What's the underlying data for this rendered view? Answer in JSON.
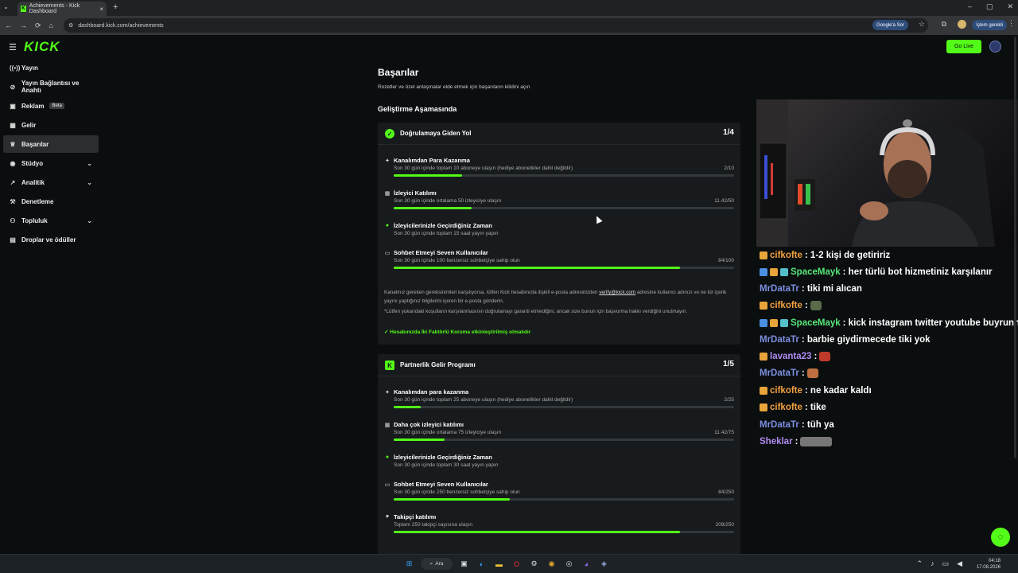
{
  "browser": {
    "tab_title": "Achievements - Kick Dashboard",
    "url": "dashboard.kick.com/achievements",
    "google_button": "Google'a Sor",
    "paused_label": "İşlem gerekli"
  },
  "header": {
    "logo": "KICK",
    "go_live": "Go Live"
  },
  "sidebar": {
    "items": [
      {
        "label": "Yayın",
        "icon": "broadcast-icon"
      },
      {
        "label": "Yayın Bağlantısı ve Anahtı",
        "icon": "link-icon"
      },
      {
        "label": "Reklam",
        "icon": "ad-icon",
        "badge": "Beta"
      },
      {
        "label": "Gelir",
        "icon": "money-icon"
      },
      {
        "label": "Başarılar",
        "icon": "trophy-icon",
        "active": true
      },
      {
        "label": "Stüdyo",
        "icon": "palette-icon",
        "expandable": true
      },
      {
        "label": "Analitik",
        "icon": "chart-icon",
        "expandable": true
      },
      {
        "label": "Denetleme",
        "icon": "hammer-icon"
      },
      {
        "label": "Topluluk",
        "icon": "people-icon",
        "expandable": true
      },
      {
        "label": "Droplar ve ödüller",
        "icon": "gift-icon"
      }
    ]
  },
  "main": {
    "title": "Başarılar",
    "subtitle": "Rozetler ve özel anlaşmalar elde etmek için başarıların kilidini açın",
    "section_title": "Geliştirme Aşamasında",
    "verify_card": {
      "title": "Doğrulamaya Giden Yol",
      "count": "1/4",
      "requirements": [
        {
          "title": "Kanalımdan Para Kazanma",
          "desc": "Son 30 gün içinde toplam 10 aboneye ulaşın (hediye abonelikler dahil değildir)",
          "value": "2/10",
          "progress": 0.2,
          "icon": "sparkle-icon"
        },
        {
          "title": "İzleyici Katılımı",
          "desc": "Son 30 gün içinde ortalama 50 izleyiciye ulaşın",
          "value": "11.42/50",
          "progress": 0.23,
          "icon": "audience-icon"
        },
        {
          "title": "İzleyicilerinizle Geçirdiğiniz Zaman",
          "desc": "Son 30 gün içinde toplam 15 saat yayın yapın",
          "value": "",
          "progress": null,
          "icon": "check-circle-icon",
          "complete": true
        },
        {
          "title": "Sohbet Etmeyi Seven Kullanıcılar",
          "desc": "Son 30 gün içinde 100 benzersiz sohbetçiye sahip olun",
          "value": "84/100",
          "progress": 0.84,
          "icon": "chat-icon"
        }
      ],
      "note_1a": "Kanalınız gereken gereksinimleri karşılıyorsa, lütfen Kick hesabınızla ilişkili e-posta adresinizden ",
      "note_email": "verify@kick.com",
      "note_1b": " adresine kullanıcı adınızı ve ne tür içerik yayını yaptığınız bilgilerini içeren bir e-posta gönderin.",
      "note_2": "*Lütfen yukarıdaki koşulların karşılanmasının doğrulamayı garanti etmediğini, ancak size bunun için başvurma hakkı verdiğini unutmayın.",
      "two_factor": "Hesabınızda İki Faktörlü Koruma etkinleştirilmiş olmalıdır"
    },
    "partner_card": {
      "title": "Partnerlik Gelir Programı",
      "count": "1/5",
      "requirements": [
        {
          "title": "Kanalımdan para kazanma",
          "desc": "Son 30 gün içinde toplam 25 aboneye ulaşın (hediye abonelikler dahil değildir)",
          "value": "2/25",
          "progress": 0.08,
          "icon": "sparkle-icon"
        },
        {
          "title": "Daha çok izleyici katılımı",
          "desc": "Son 30 gün içinde ortalama 75 izleyiciye ulaşın",
          "value": "11.42/75",
          "progress": 0.15,
          "icon": "audience-icon"
        },
        {
          "title": "İzleyicilerinizle Geçirdiğiniz Zaman",
          "desc": "Son 30 gün içinde toplam 30 saat yayın yapın",
          "value": "",
          "progress": null,
          "icon": "check-circle-icon",
          "complete": true
        },
        {
          "title": "Sohbet Etmeyi Seven Kullanıcılar",
          "desc": "Son 30 gün içinde 250 benzersiz sohbetçiye sahip olun",
          "value": "84/250",
          "progress": 0.34,
          "icon": "chat-icon"
        },
        {
          "title": "Takipçi katılımı",
          "desc": "Toplam 250 takipçi sayısına ulaşın",
          "value": "209/250",
          "progress": 0.84,
          "icon": "heart-icon"
        }
      ]
    }
  },
  "chat": {
    "messages": [
      {
        "user": "cifkofte",
        "text": ": 1-2 kişi de getiririz",
        "color": "orange",
        "badges": [
          "#e8a33a"
        ]
      },
      {
        "user": "SpaceMayk",
        "text": ": her türlü bot hizmetiniz karşılanır",
        "color": "green",
        "badges": [
          "#4a90e2",
          "#e8a33a",
          "#53c0c9"
        ]
      },
      {
        "user": "MrDataTr",
        "text": ": tiki mi alıcan",
        "color": "blue",
        "badges": []
      },
      {
        "user": "cifkofte",
        "text": ":",
        "color": "orange",
        "badges": [
          "#e8a33a"
        ],
        "emote": "#5a6a4a"
      },
      {
        "user": "SpaceMayk",
        "text": ": kick instagram twitter youtube buyrunn",
        "color": "green",
        "badges": [
          "#4a90e2",
          "#e8a33a",
          "#53c0c9"
        ]
      },
      {
        "user": "MrDataTr",
        "text": ": barbie giydirmecede tiki yok",
        "color": "blue",
        "badges": []
      },
      {
        "user": "lavanta23",
        "text": ":",
        "color": "purple",
        "badges": [
          "#e8a33a"
        ],
        "emote": "#c0392b"
      },
      {
        "user": "MrDataTr",
        "text": ":",
        "color": "blue",
        "badges": [],
        "emote": "#c07040"
      },
      {
        "user": "cifkofte",
        "text": ": ne kadar kaldı",
        "color": "orange",
        "badges": [
          "#e8a33a"
        ]
      },
      {
        "user": "cifkofte",
        "text": ": tike",
        "color": "orange",
        "badges": [
          "#e8a33a"
        ]
      },
      {
        "user": "MrDataTr",
        "text": ": tüh ya",
        "color": "blue",
        "badges": []
      },
      {
        "user": "Sheklar",
        "text": ":",
        "color": "purple",
        "badges": [],
        "emote": "#777777"
      }
    ]
  },
  "taskbar": {
    "search": "Ara",
    "time": "04:18",
    "date": "17.08.2026"
  },
  "colors": {
    "accent": "#53fc18",
    "background": "#0b0e0f",
    "card": "#181b1d"
  }
}
